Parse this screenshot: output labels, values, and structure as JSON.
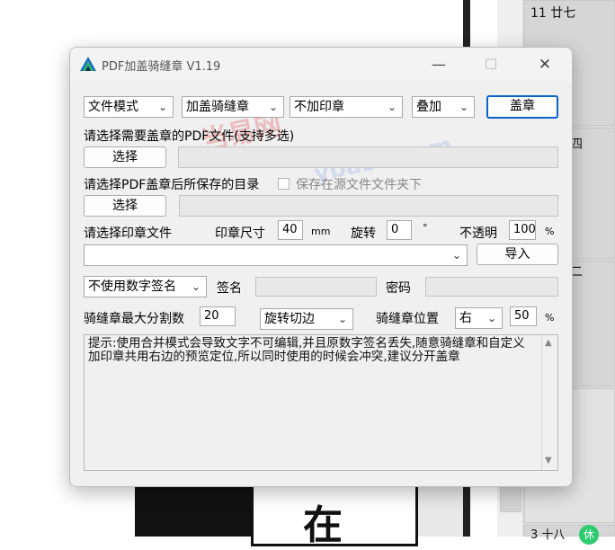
{
  "background": {
    "calendar_cells": [
      {
        "label": "11 廿七"
      },
      {
        "label": "四"
      },
      {
        "label": "二"
      },
      {
        "label": "3 十八"
      }
    ],
    "badge_label": "休",
    "big_char": "在"
  },
  "window": {
    "title": "PDF加盖骑缝章 V1.19",
    "controls": {
      "minimize": "—",
      "maximize": "☐",
      "close": "✕"
    }
  },
  "row1": {
    "mode_select": "文件模式",
    "stamp_type_select": "加盖骑缝章",
    "seal_select": "不加印章",
    "overlay_select": "叠加",
    "stamp_button": "盖章"
  },
  "pdf_select": {
    "label": "请选择需要盖章的PDF文件(支持多选)",
    "button": "选择",
    "path": ""
  },
  "output_dir": {
    "label": "请选择PDF盖章后所保存的目录",
    "checkbox_label": "保存在源文件文件夹下",
    "button": "选择",
    "path": ""
  },
  "seal_file": {
    "label": "请选择印章文件",
    "size_label": "印章尺寸",
    "size_value": "40",
    "size_unit": "mm",
    "rotate_label": "旋转",
    "rotate_value": "0",
    "rotate_unit": "°",
    "opacity_label": "不透明",
    "opacity_value": "100",
    "opacity_unit": "%",
    "combo_value": "",
    "import_button": "导入"
  },
  "signature": {
    "select": "不使用数字签名",
    "sign_label": "签名",
    "password_label": "密码"
  },
  "seam": {
    "max_split_label": "骑缝章最大分割数",
    "max_split_value": "20",
    "cut_select": "旋转切边",
    "position_label": "骑缝章位置",
    "position_select": "右",
    "position_value": "50",
    "position_unit": "%"
  },
  "hint": {
    "text": "提示:使用合并模式会导致文字不可编辑,并且原数字签名丢失,随意骑缝章和自定义加印章共用右边的预览定位,所以同时使用的时候会冲突,建议分开盖章"
  },
  "watermarks": [
    "当易网",
    "ybase.com"
  ]
}
